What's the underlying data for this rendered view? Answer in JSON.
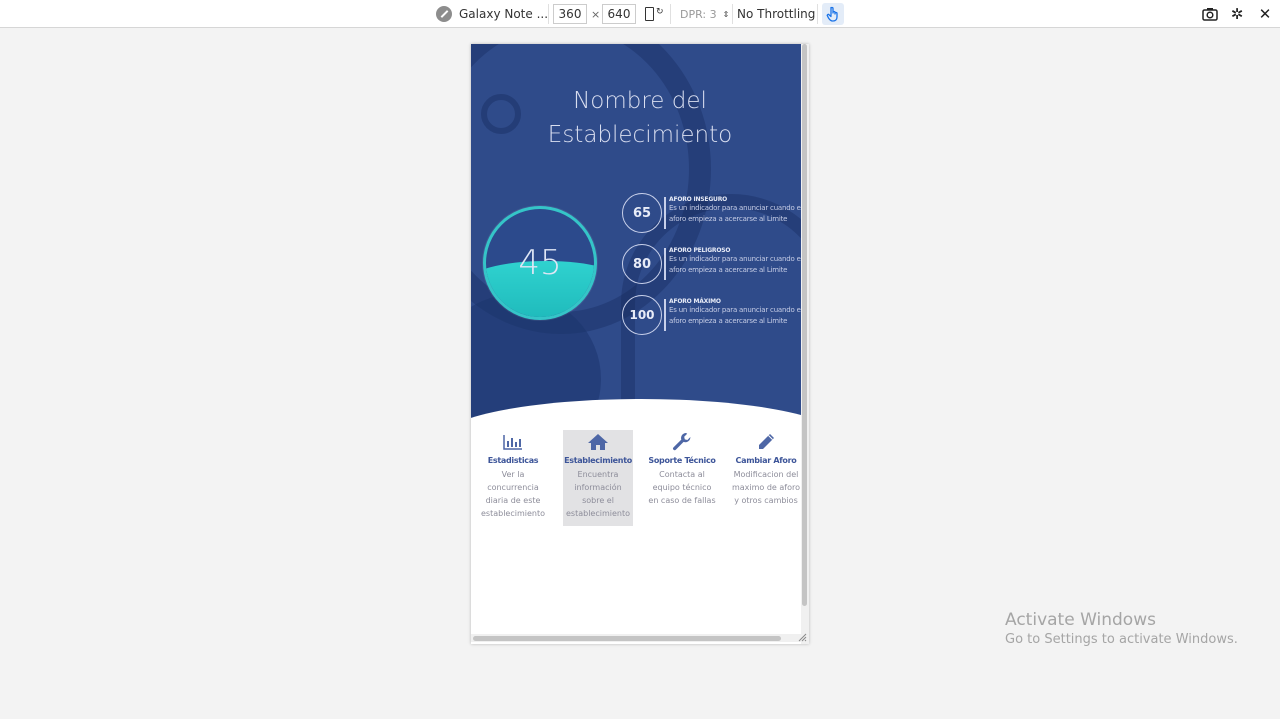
{
  "toolbar": {
    "device_name": "Galaxy Note ...",
    "width": "360",
    "height": "640",
    "times": "×",
    "dpr": "DPR: 3",
    "throttling": "No Throttling",
    "caret": "⇕"
  },
  "page": {
    "title_line1": "Nombre del",
    "title_line2": "Establecimiento",
    "gauge_value": "45",
    "levels": [
      {
        "value": "65",
        "title": "AFORO INSEGURO",
        "desc_line1": "Es un indicador para anunciar cuando el",
        "desc_line2": "aforo empieza a acercarse al Limite"
      },
      {
        "value": "80",
        "title": "AFORO PELIGROSO",
        "desc_line1": "Es un indicador para anunciar cuando el",
        "desc_line2": "aforo empieza a acercarse al Limite"
      },
      {
        "value": "100",
        "title": "AFORO MÁXIMO",
        "desc_line1": "Es un indicador para anunciar cuando el",
        "desc_line2": "aforo empieza a acercarse al Limite"
      }
    ],
    "menu": [
      {
        "icon": "bar-chart-icon",
        "label": "Estadisticas",
        "desc": "Ver la concurrencia diaria de este establecimiento"
      },
      {
        "icon": "home-icon",
        "label": "Establecimiento",
        "desc": "Encuentra información sobre el establecimiento"
      },
      {
        "icon": "wrench-icon",
        "label": "Soporte Técnico",
        "desc": "Contacta al equipo técnico en caso de fallas"
      },
      {
        "icon": "pencil-icon",
        "label": "Cambiar Aforo",
        "desc": "Modificacion del maximo de aforo y otros cambios"
      }
    ]
  },
  "watermark": {
    "title": "Activate Windows",
    "subtitle": "Go to Settings to activate Windows."
  },
  "colors": {
    "hero_bg": "#2f4b8a",
    "gauge_fill": "#2fd2cf",
    "menu_accent": "#3d5599"
  }
}
